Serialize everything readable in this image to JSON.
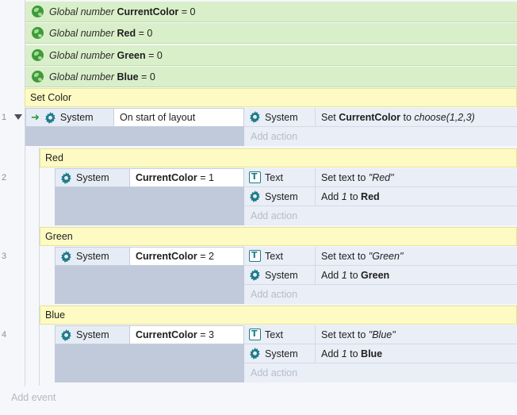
{
  "global_variables": [
    {
      "keyword": "Global number",
      "name": "CurrentColor",
      "rest": " = 0"
    },
    {
      "keyword": "Global number",
      "name": "Red",
      "rest": " = 0"
    },
    {
      "keyword": "Global number",
      "name": "Green",
      "rest": " = 0"
    },
    {
      "keyword": "Global number",
      "name": "Blue",
      "rest": " = 0"
    }
  ],
  "group": {
    "name": "Set Color"
  },
  "row_numbers": [
    "1",
    "2",
    "3",
    "4"
  ],
  "event1": {
    "cond_object": "System",
    "cond_text": "On start of layout",
    "action_object": "System",
    "action_pre": "Set ",
    "action_bold": "CurrentColor",
    "action_mid": " to ",
    "action_italic": "choose(1,2,3)"
  },
  "subevents": [
    {
      "group": "Red",
      "cond_object": "System",
      "cond_var": "CurrentColor",
      "cond_rest": " = 1",
      "a1_object": "Text",
      "a1_pre": "Set text to ",
      "a1_italic": "\"Red\"",
      "a2_object": "System",
      "a2_pre": "Add ",
      "a2_italic": "1",
      "a2_mid": " to ",
      "a2_bold": "Red"
    },
    {
      "group": "Green",
      "cond_object": "System",
      "cond_var": "CurrentColor",
      "cond_rest": " = 2",
      "a1_object": "Text",
      "a1_pre": "Set text to ",
      "a1_italic": "\"Green\"",
      "a2_object": "System",
      "a2_pre": "Add ",
      "a2_italic": "1",
      "a2_mid": " to ",
      "a2_bold": "Green"
    },
    {
      "group": "Blue",
      "cond_object": "System",
      "cond_var": "CurrentColor",
      "cond_rest": " = 3",
      "a1_object": "Text",
      "a1_pre": "Set text to ",
      "a1_italic": "\"Blue\"",
      "a2_object": "System",
      "a2_pre": "Add ",
      "a2_italic": "1",
      "a2_mid": " to ",
      "a2_bold": "Blue"
    }
  ],
  "add_action_label": "Add action",
  "add_event_label": "Add event",
  "icons": {
    "global": "globe-icon",
    "system": "gear-icon",
    "text": "text-object-icon",
    "trigger": "trigger-arrow-icon"
  },
  "colors": {
    "global_bg": "#d9efc9",
    "group_bg": "#fdfbc3",
    "condition_bg": "#e6ecf5",
    "system_icon": "#1f7c8a"
  }
}
